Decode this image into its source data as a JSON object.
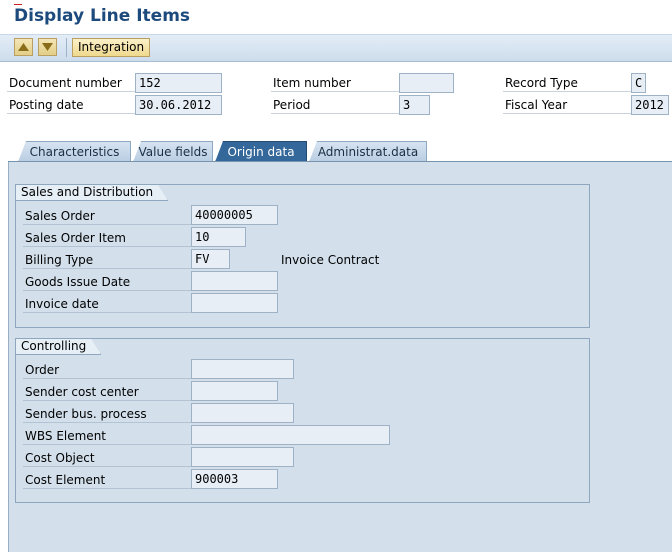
{
  "title": "Display Line Items",
  "toolbar": {
    "up_icon": "triangle-up-icon",
    "down_icon": "triangle-down-icon",
    "integration_label": "Integration"
  },
  "header": {
    "document_number": {
      "label": "Document number",
      "value": "152"
    },
    "posting_date": {
      "label": "Posting date",
      "value": "30.06.2012"
    },
    "item_number": {
      "label": "Item number",
      "value": ""
    },
    "period": {
      "label": "Period",
      "value": "3"
    },
    "record_type": {
      "label": "Record Type",
      "value": "C"
    },
    "fiscal_year": {
      "label": "Fiscal Year",
      "value": "2012"
    }
  },
  "tabs": [
    {
      "label": "Characteristics",
      "active": false
    },
    {
      "label": "Value fields",
      "active": false
    },
    {
      "label": "Origin data",
      "active": true
    },
    {
      "label": "Administrat.data",
      "active": false
    }
  ],
  "sales": {
    "title": "Sales and Distribution",
    "sales_order": {
      "label": "Sales Order",
      "value": "40000005"
    },
    "sales_order_item": {
      "label": "Sales Order Item",
      "value": "10"
    },
    "billing_type": {
      "label": "Billing Type",
      "value": "FV",
      "description": "Invoice Contract"
    },
    "goods_issue_date": {
      "label": "Goods Issue Date",
      "value": ""
    },
    "invoice_date": {
      "label": "Invoice date",
      "value": ""
    }
  },
  "controlling": {
    "title": "Controlling",
    "order": {
      "label": "Order",
      "value": ""
    },
    "sender_cost_center": {
      "label": "Sender cost center",
      "value": ""
    },
    "sender_bus_process": {
      "label": "Sender bus. process",
      "value": ""
    },
    "wbs_element": {
      "label": "WBS Element",
      "value": ""
    },
    "cost_object": {
      "label": "Cost Object",
      "value": ""
    },
    "cost_element": {
      "label": "Cost Element",
      "value": "900003"
    }
  },
  "colors": {
    "title": "#1d4a7c",
    "active_tab": "#35689a",
    "pane_background": "#d3e0ec"
  }
}
